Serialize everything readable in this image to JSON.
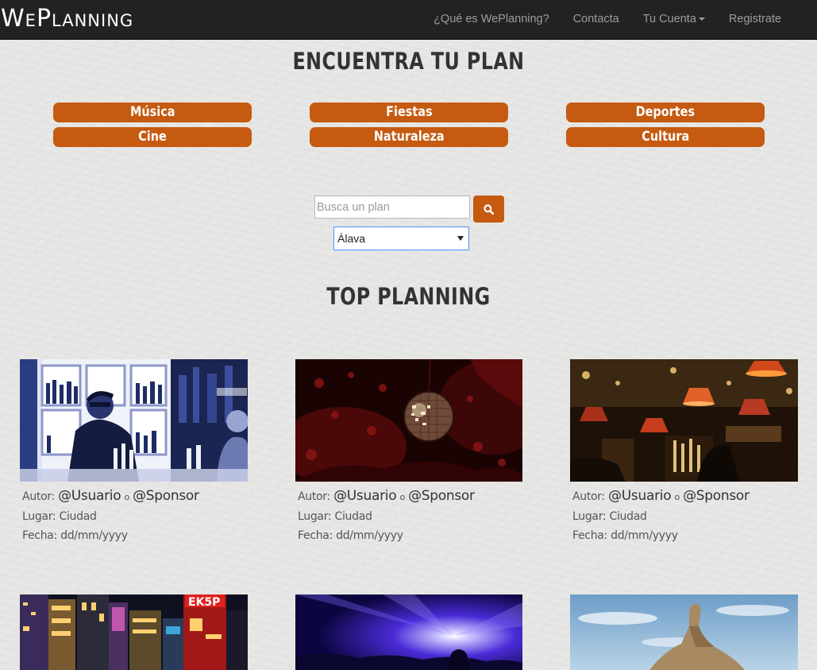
{
  "navbar": {
    "brand_cap1": "W",
    "brand_small1": "E",
    "brand_cap2": "P",
    "brand_small2": "LANNING",
    "links": [
      {
        "label": "¿Qué es WePlanning?"
      },
      {
        "label": "Contacta"
      },
      {
        "label": "Tu Cuenta"
      },
      {
        "label": "Registrate"
      }
    ]
  },
  "plan_section": {
    "title": "ENCUENTRA TU PLAN",
    "categories": [
      "Música",
      "Fiestas",
      "Deportes",
      "Cine",
      "Naturaleza",
      "Cultura"
    ]
  },
  "search": {
    "placeholder": "Busca un plan",
    "icon": "search-icon",
    "province_selected": "Álava"
  },
  "top_section": {
    "title": "TOP PLANNING"
  },
  "cards": [
    {
      "image": "bartender-photo",
      "author_label": "Autor:",
      "author_user": "@Usuario",
      "or": "o",
      "author_sponsor": "@Sponsor",
      "place": "Lugar: Ciudad",
      "date": "Fecha: dd/mm/yyyy"
    },
    {
      "image": "disco-ball-photo",
      "author_label": "Autor:",
      "author_user": "@Usuario",
      "or": "o",
      "author_sponsor": "@Sponsor",
      "place": "Lugar: Ciudad",
      "date": "Fecha: dd/mm/yyyy"
    },
    {
      "image": "lamps-bar-photo",
      "author_label": "Autor:",
      "author_user": "@Usuario",
      "or": "o",
      "author_sponsor": "@Sponsor",
      "place": "Lugar: Ciudad",
      "date": "Fecha: dd/mm/yyyy"
    },
    {
      "image": "city-night-photo",
      "sign_text": "EK5P"
    },
    {
      "image": "concert-photo"
    },
    {
      "image": "rock-formation-photo"
    }
  ],
  "colors": {
    "accent": "#c55a10",
    "navbar": "#222222",
    "nav_text": "#9d9d9d",
    "heading": "#333333"
  }
}
